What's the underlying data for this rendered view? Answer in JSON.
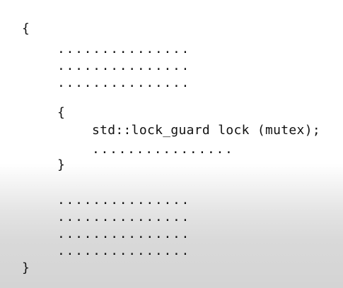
{
  "code": {
    "outer_open": "{",
    "dots_block1": [
      "...............",
      "...............",
      "..............."
    ],
    "inner_open": "{",
    "lock_line": "std::lock_guard lock (mutex);",
    "inner_dots": "................",
    "inner_close": "}",
    "dots_block2": [
      "...............",
      "...............",
      "...............",
      "..............."
    ],
    "outer_close": "}"
  }
}
